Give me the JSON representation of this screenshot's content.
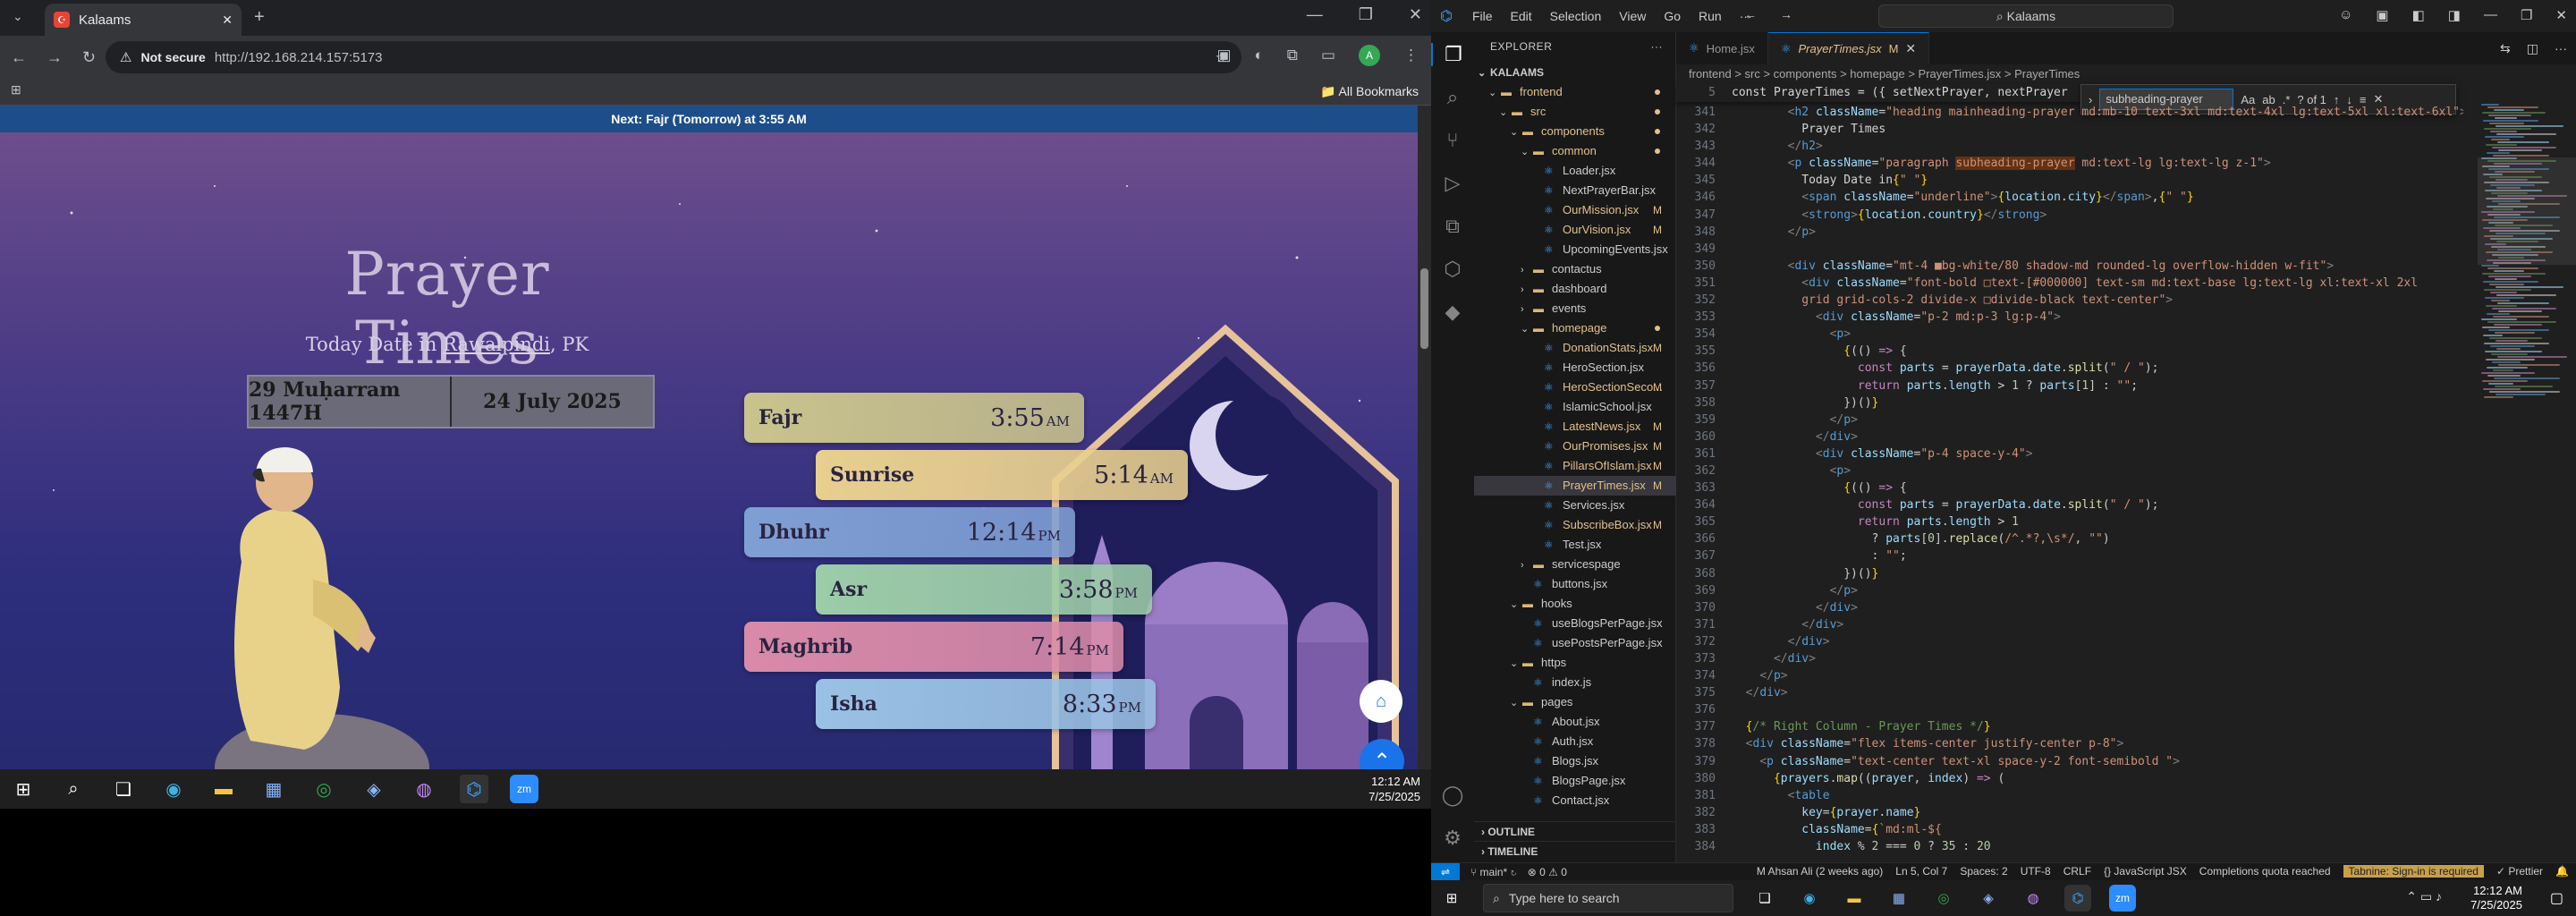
{
  "browser": {
    "tab_title": "Kalaams",
    "url_security": "Not secure",
    "url": "http://192.168.214.157:5173",
    "bookmarks_label": "All Bookmarks",
    "profile_initial": "A"
  },
  "site": {
    "next_prayer_bar": "Next: Fajr (Tomorrow) at 3:55 AM",
    "title": "Prayer Times",
    "today_prefix": "Today Date in",
    "city": "Rawalpindi",
    "country": ", PK",
    "hijri_date": "29 Muḥarram 1447H",
    "gregorian_date": "24 July 2025",
    "prayers": [
      {
        "name": "Fajr",
        "time": "3:55",
        "ampm": "AM",
        "color": "#c9c38d"
      },
      {
        "name": "Sunrise",
        "time": "5:14",
        "ampm": "AM",
        "color": "#e8cf8f"
      },
      {
        "name": "Dhuhr",
        "time": "12:14",
        "ampm": "PM",
        "color": "#7f9fd4"
      },
      {
        "name": "Asr",
        "time": "3:58",
        "ampm": "PM",
        "color": "#9ccca8"
      },
      {
        "name": "Maghrib",
        "time": "7:14",
        "ampm": "PM",
        "color": "#d98aa8"
      },
      {
        "name": "Isha",
        "time": "8:33",
        "ampm": "PM",
        "color": "#9ac1e4"
      }
    ]
  },
  "left_taskbar": {
    "time": "12:12 AM",
    "date": "7/25/2025"
  },
  "vscode": {
    "menu": [
      "File",
      "Edit",
      "Selection",
      "View",
      "Go",
      "Run",
      "···"
    ],
    "command_center": "Kalaams",
    "explorer_title": "EXPLORER",
    "root": "KALAAMS",
    "tree": [
      {
        "depth": 1,
        "kind": "folder",
        "name": "frontend",
        "open": true,
        "dot": true
      },
      {
        "depth": 2,
        "kind": "folder",
        "name": "src",
        "open": true,
        "dot": true
      },
      {
        "depth": 3,
        "kind": "folder",
        "name": "components",
        "open": true,
        "dot": true
      },
      {
        "depth": 4,
        "kind": "folder",
        "name": "common",
        "open": true,
        "dot": true
      },
      {
        "depth": 5,
        "kind": "file",
        "name": "Loader.jsx"
      },
      {
        "depth": 5,
        "kind": "file",
        "name": "NextPrayerBar.jsx"
      },
      {
        "depth": 5,
        "kind": "file",
        "name": "OurMission.jsx",
        "badge": "M"
      },
      {
        "depth": 5,
        "kind": "file",
        "name": "OurVision.jsx",
        "badge": "M"
      },
      {
        "depth": 5,
        "kind": "file",
        "name": "UpcomingEvents.jsx"
      },
      {
        "depth": 4,
        "kind": "folder",
        "name": "contactus",
        "open": false
      },
      {
        "depth": 4,
        "kind": "folder",
        "name": "dashboard",
        "open": false
      },
      {
        "depth": 4,
        "kind": "folder",
        "name": "events",
        "open": false
      },
      {
        "depth": 4,
        "kind": "folder",
        "name": "homepage",
        "open": true,
        "dot": true
      },
      {
        "depth": 5,
        "kind": "file",
        "name": "DonationStats.jsx",
        "badge": "M"
      },
      {
        "depth": 5,
        "kind": "file",
        "name": "HeroSection.jsx"
      },
      {
        "depth": 5,
        "kind": "file",
        "name": "HeroSectionSeco...",
        "badge": "M"
      },
      {
        "depth": 5,
        "kind": "file",
        "name": "IslamicSchool.jsx"
      },
      {
        "depth": 5,
        "kind": "file",
        "name": "LatestNews.jsx",
        "badge": "M"
      },
      {
        "depth": 5,
        "kind": "file",
        "name": "OurPromises.jsx",
        "badge": "M"
      },
      {
        "depth": 5,
        "kind": "file",
        "name": "PillarsOfIslam.jsx",
        "badge": "M"
      },
      {
        "depth": 5,
        "kind": "file",
        "name": "PrayerTimes.jsx",
        "badge": "M",
        "selected": true
      },
      {
        "depth": 5,
        "kind": "file",
        "name": "Services.jsx"
      },
      {
        "depth": 5,
        "kind": "file",
        "name": "SubscribeBox.jsx",
        "badge": "M"
      },
      {
        "depth": 5,
        "kind": "file",
        "name": "Test.jsx"
      },
      {
        "depth": 4,
        "kind": "folder",
        "name": "servicespage",
        "open": false
      },
      {
        "depth": 4,
        "kind": "file",
        "name": "buttons.jsx"
      },
      {
        "depth": 3,
        "kind": "folder",
        "name": "hooks",
        "open": true
      },
      {
        "depth": 4,
        "kind": "file",
        "name": "useBlogsPerPage.jsx"
      },
      {
        "depth": 4,
        "kind": "file",
        "name": "usePostsPerPage.jsx"
      },
      {
        "depth": 3,
        "kind": "folder",
        "name": "https",
        "open": true
      },
      {
        "depth": 4,
        "kind": "file",
        "name": "index.js"
      },
      {
        "depth": 3,
        "kind": "folder",
        "name": "pages",
        "open": true
      },
      {
        "depth": 4,
        "kind": "file",
        "name": "About.jsx"
      },
      {
        "depth": 4,
        "kind": "file",
        "name": "Auth.jsx"
      },
      {
        "depth": 4,
        "kind": "file",
        "name": "Blogs.jsx"
      },
      {
        "depth": 4,
        "kind": "file",
        "name": "BlogsPage.jsx"
      },
      {
        "depth": 4,
        "kind": "file",
        "name": "Contact.jsx"
      }
    ],
    "outline_label": "OUTLINE",
    "timeline_label": "TIMELINE",
    "tabs": [
      {
        "name": "Home.jsx",
        "active": false
      },
      {
        "name": "PrayerTimes.jsx",
        "active": true,
        "badge": "M"
      }
    ],
    "breadcrumb": "frontend > src > components > homepage > PrayerTimes.jsx > PrayerTimes",
    "sticky_line_no": "5",
    "sticky_text": "const PrayerTimes = ({ setNextPrayer, nextPrayer",
    "find_query": "subheading-prayer",
    "find_count": "? of 1",
    "code_lines": [
      {
        "n": "341",
        "html": "        <span class='t-pun'>&lt;</span><span class='t-tag'>h2</span> <span class='t-attr'>className</span>=<span class='t-str'>\"heading mainheading-prayer md:mb-10 text-3xl md:text-4xl lg:text-5xl xl:text-6xl\"</span><span class='t-pun'>&gt;</span>"
      },
      {
        "n": "342",
        "html": "          <span class='t-txt'>Prayer Times</span>"
      },
      {
        "n": "343",
        "html": "        <span class='t-pun'>&lt;/</span><span class='t-tag'>h2</span><span class='t-pun'>&gt;</span>"
      },
      {
        "n": "344",
        "html": "        <span class='t-pun'>&lt;</span><span class='t-tag'>p</span> <span class='t-attr'>className</span>=<span class='t-str'>\"paragraph <span class='hl'>subheading-prayer</span> md:text-lg lg:text-lg z-1\"</span><span class='t-pun'>&gt;</span>"
      },
      {
        "n": "345",
        "html": "          <span class='t-txt'>Today Date in</span><span class='t-br'>{</span><span class='t-str'>\" \"</span><span class='t-br'>}</span>"
      },
      {
        "n": "346",
        "html": "          <span class='t-pun'>&lt;</span><span class='t-tag'>span</span> <span class='t-attr'>className</span>=<span class='t-str'>\"underline\"</span><span class='t-pun'>&gt;</span><span class='t-br'>{</span><span class='t-var'>location</span>.<span class='t-var'>city</span><span class='t-br'>}</span><span class='t-pun'>&lt;/</span><span class='t-tag'>span</span><span class='t-pun'>&gt;</span>,<span class='t-br'>{</span><span class='t-str'>\" \"</span><span class='t-br'>}</span>"
      },
      {
        "n": "347",
        "html": "          <span class='t-pun'>&lt;</span><span class='t-tag'>strong</span><span class='t-pun'>&gt;</span><span class='t-br'>{</span><span class='t-var'>location</span>.<span class='t-var'>country</span><span class='t-br'>}</span><span class='t-pun'>&lt;/</span><span class='t-tag'>strong</span><span class='t-pun'>&gt;</span>"
      },
      {
        "n": "348",
        "html": "        <span class='t-pun'>&lt;/</span><span class='t-tag'>p</span><span class='t-pun'>&gt;</span>"
      },
      {
        "n": "349",
        "html": ""
      },
      {
        "n": "350",
        "html": "        <span class='t-pun'>&lt;</span><span class='t-tag'>div</span> <span class='t-attr'>className</span>=<span class='t-str'>\"mt-4 ■bg-white/80 shadow-md rounded-lg overflow-hidden w-fit\"</span><span class='t-pun'>&gt;</span>"
      },
      {
        "n": "351",
        "html": "          <span class='t-pun'>&lt;</span><span class='t-tag'>div</span> <span class='t-attr'>className</span>=<span class='t-str'>\"font-bold □text-[#000000] text-sm md:text-base lg:text-lg xl:text-xl 2xl</span>"
      },
      {
        "n": "352",
        "html": "          <span class='t-str'>grid grid-cols-2 divide-x □divide-black text-center\"</span><span class='t-pun'>&gt;</span>"
      },
      {
        "n": "353",
        "html": "            <span class='t-pun'>&lt;</span><span class='t-tag'>div</span> <span class='t-attr'>className</span>=<span class='t-str'>\"p-2 md:p-3 lg:p-4\"</span><span class='t-pun'>&gt;</span>"
      },
      {
        "n": "354",
        "html": "              <span class='t-pun'>&lt;</span><span class='t-tag'>p</span><span class='t-pun'>&gt;</span>"
      },
      {
        "n": "355",
        "html": "                <span class='t-br'>{</span>(() <span class='t-kw'>=&gt;</span> {"
      },
      {
        "n": "356",
        "html": "                  <span class='t-kw'>const</span> <span class='t-var'>parts</span> = <span class='t-var'>prayerData</span>.<span class='t-var'>date</span>.<span class='t-fn'>split</span>(<span class='t-str'>\" / \"</span>);"
      },
      {
        "n": "357",
        "html": "                  <span class='t-kw'>return</span> <span class='t-var'>parts</span>.<span class='t-var'>length</span> &gt; <span class='t-num'>1</span> ? <span class='t-var'>parts</span>[<span class='t-num'>1</span>] : <span class='t-str'>\"\"</span>;"
      },
      {
        "n": "358",
        "html": "                })()<span class='t-br'>}</span>"
      },
      {
        "n": "359",
        "html": "              <span class='t-pun'>&lt;/</span><span class='t-tag'>p</span><span class='t-pun'>&gt;</span>"
      },
      {
        "n": "360",
        "html": "            <span class='t-pun'>&lt;/</span><span class='t-tag'>div</span><span class='t-pun'>&gt;</span>"
      },
      {
        "n": "361",
        "html": "            <span class='t-pun'>&lt;</span><span class='t-tag'>div</span> <span class='t-attr'>className</span>=<span class='t-str'>\"p-4 space-y-4\"</span><span class='t-pun'>&gt;</span>"
      },
      {
        "n": "362",
        "html": "              <span class='t-pun'>&lt;</span><span class='t-tag'>p</span><span class='t-pun'>&gt;</span>"
      },
      {
        "n": "363",
        "html": "                <span class='t-br'>{</span>(() <span class='t-kw'>=&gt;</span> {"
      },
      {
        "n": "364",
        "html": "                  <span class='t-kw'>const</span> <span class='t-var'>parts</span> = <span class='t-var'>prayerData</span>.<span class='t-var'>date</span>.<span class='t-fn'>split</span>(<span class='t-str'>\" / \"</span>);"
      },
      {
        "n": "365",
        "html": "                  <span class='t-kw'>return</span> <span class='t-var'>parts</span>.<span class='t-var'>length</span> &gt; <span class='t-num'>1</span>"
      },
      {
        "n": "366",
        "html": "                    ? <span class='t-var'>parts</span>[<span class='t-num'>0</span>].<span class='t-fn'>replace</span>(<span class='t-str'>/^.*?,\\s*/</span>, <span class='t-str'>\"\"</span>)"
      },
      {
        "n": "367",
        "html": "                    : <span class='t-str'>\"\"</span>;"
      },
      {
        "n": "368",
        "html": "                })()<span class='t-br'>}</span>"
      },
      {
        "n": "369",
        "html": "              <span class='t-pun'>&lt;/</span><span class='t-tag'>p</span><span class='t-pun'>&gt;</span>"
      },
      {
        "n": "370",
        "html": "            <span class='t-pun'>&lt;/</span><span class='t-tag'>div</span><span class='t-pun'>&gt;</span>"
      },
      {
        "n": "371",
        "html": "          <span class='t-pun'>&lt;/</span><span class='t-tag'>div</span><span class='t-pun'>&gt;</span>"
      },
      {
        "n": "372",
        "html": "        <span class='t-pun'>&lt;/</span><span class='t-tag'>div</span><span class='t-pun'>&gt;</span>"
      },
      {
        "n": "373",
        "html": "      <span class='t-pun'>&lt;/</span><span class='t-tag'>div</span><span class='t-pun'>&gt;</span>"
      },
      {
        "n": "374",
        "html": "    <span class='t-pun'>&lt;/</span><span class='t-tag'>p</span><span class='t-pun'>&gt;</span>"
      },
      {
        "n": "375",
        "html": "  <span class='t-pun'>&lt;/</span><span class='t-tag'>div</span><span class='t-pun'>&gt;</span>"
      },
      {
        "n": "376",
        "html": ""
      },
      {
        "n": "377",
        "html": "  <span class='t-br'>{</span><span class='t-cmt'>/* Right Column - Prayer Times */</span><span class='t-br'>}</span>"
      },
      {
        "n": "378",
        "html": "  <span class='t-pun'>&lt;</span><span class='t-tag'>div</span> <span class='t-attr'>className</span>=<span class='t-str'>\"flex items-center justify-center p-8\"</span><span class='t-pun'>&gt;</span>"
      },
      {
        "n": "379",
        "html": "    <span class='t-pun'>&lt;</span><span class='t-tag'>p</span> <span class='t-attr'>className</span>=<span class='t-str'>\"text-center text-xl space-y-2 font-semibold \"</span><span class='t-pun'>&gt;</span>"
      },
      {
        "n": "380",
        "html": "      <span class='t-br'>{</span><span class='t-var'>prayers</span>.<span class='t-fn'>map</span>((<span class='t-var'>prayer</span>, <span class='t-var'>index</span>) <span class='t-kw'>=&gt;</span> ("
      },
      {
        "n": "381",
        "html": "        <span class='t-pun'>&lt;</span><span class='t-tag'>table</span>"
      },
      {
        "n": "382",
        "html": "          <span class='t-attr'>key</span>=<span class='t-br'>{</span><span class='t-var'>prayer</span>.<span class='t-var'>name</span><span class='t-br'>}</span>"
      },
      {
        "n": "383",
        "html": "          <span class='t-attr'>className</span>=<span class='t-br'>{</span><span class='t-str'>`md:ml-${</span>"
      },
      {
        "n": "384",
        "html": "            <span class='t-var'>index</span> % <span class='t-num'>2</span> === <span class='t-num'>0</span> ? <span class='t-num'>35</span> : <span class='t-num'>20</span>"
      }
    ],
    "status": {
      "branch": "main*",
      "problems": "⊗ 0 ⚠ 0",
      "blame": "M Ahsan Ali (2 weeks ago)",
      "position": "Ln 5, Col 7",
      "spaces": "Spaces: 2",
      "encoding": "UTF-8",
      "eol": "CRLF",
      "language": "{} JavaScript JSX",
      "quota": "Completions quota reached",
      "tabnine": "Tabnine: Sign-in is required",
      "prettier": "✓ Prettier"
    }
  },
  "right_taskbar": {
    "search_placeholder": "Type here to search",
    "time": "12:12 AM",
    "date": "7/25/2025"
  },
  "colors": {
    "vscode_accent": "#0078d4",
    "site_bar": "#1d4e89",
    "fab_blue": "#1a73e8"
  }
}
